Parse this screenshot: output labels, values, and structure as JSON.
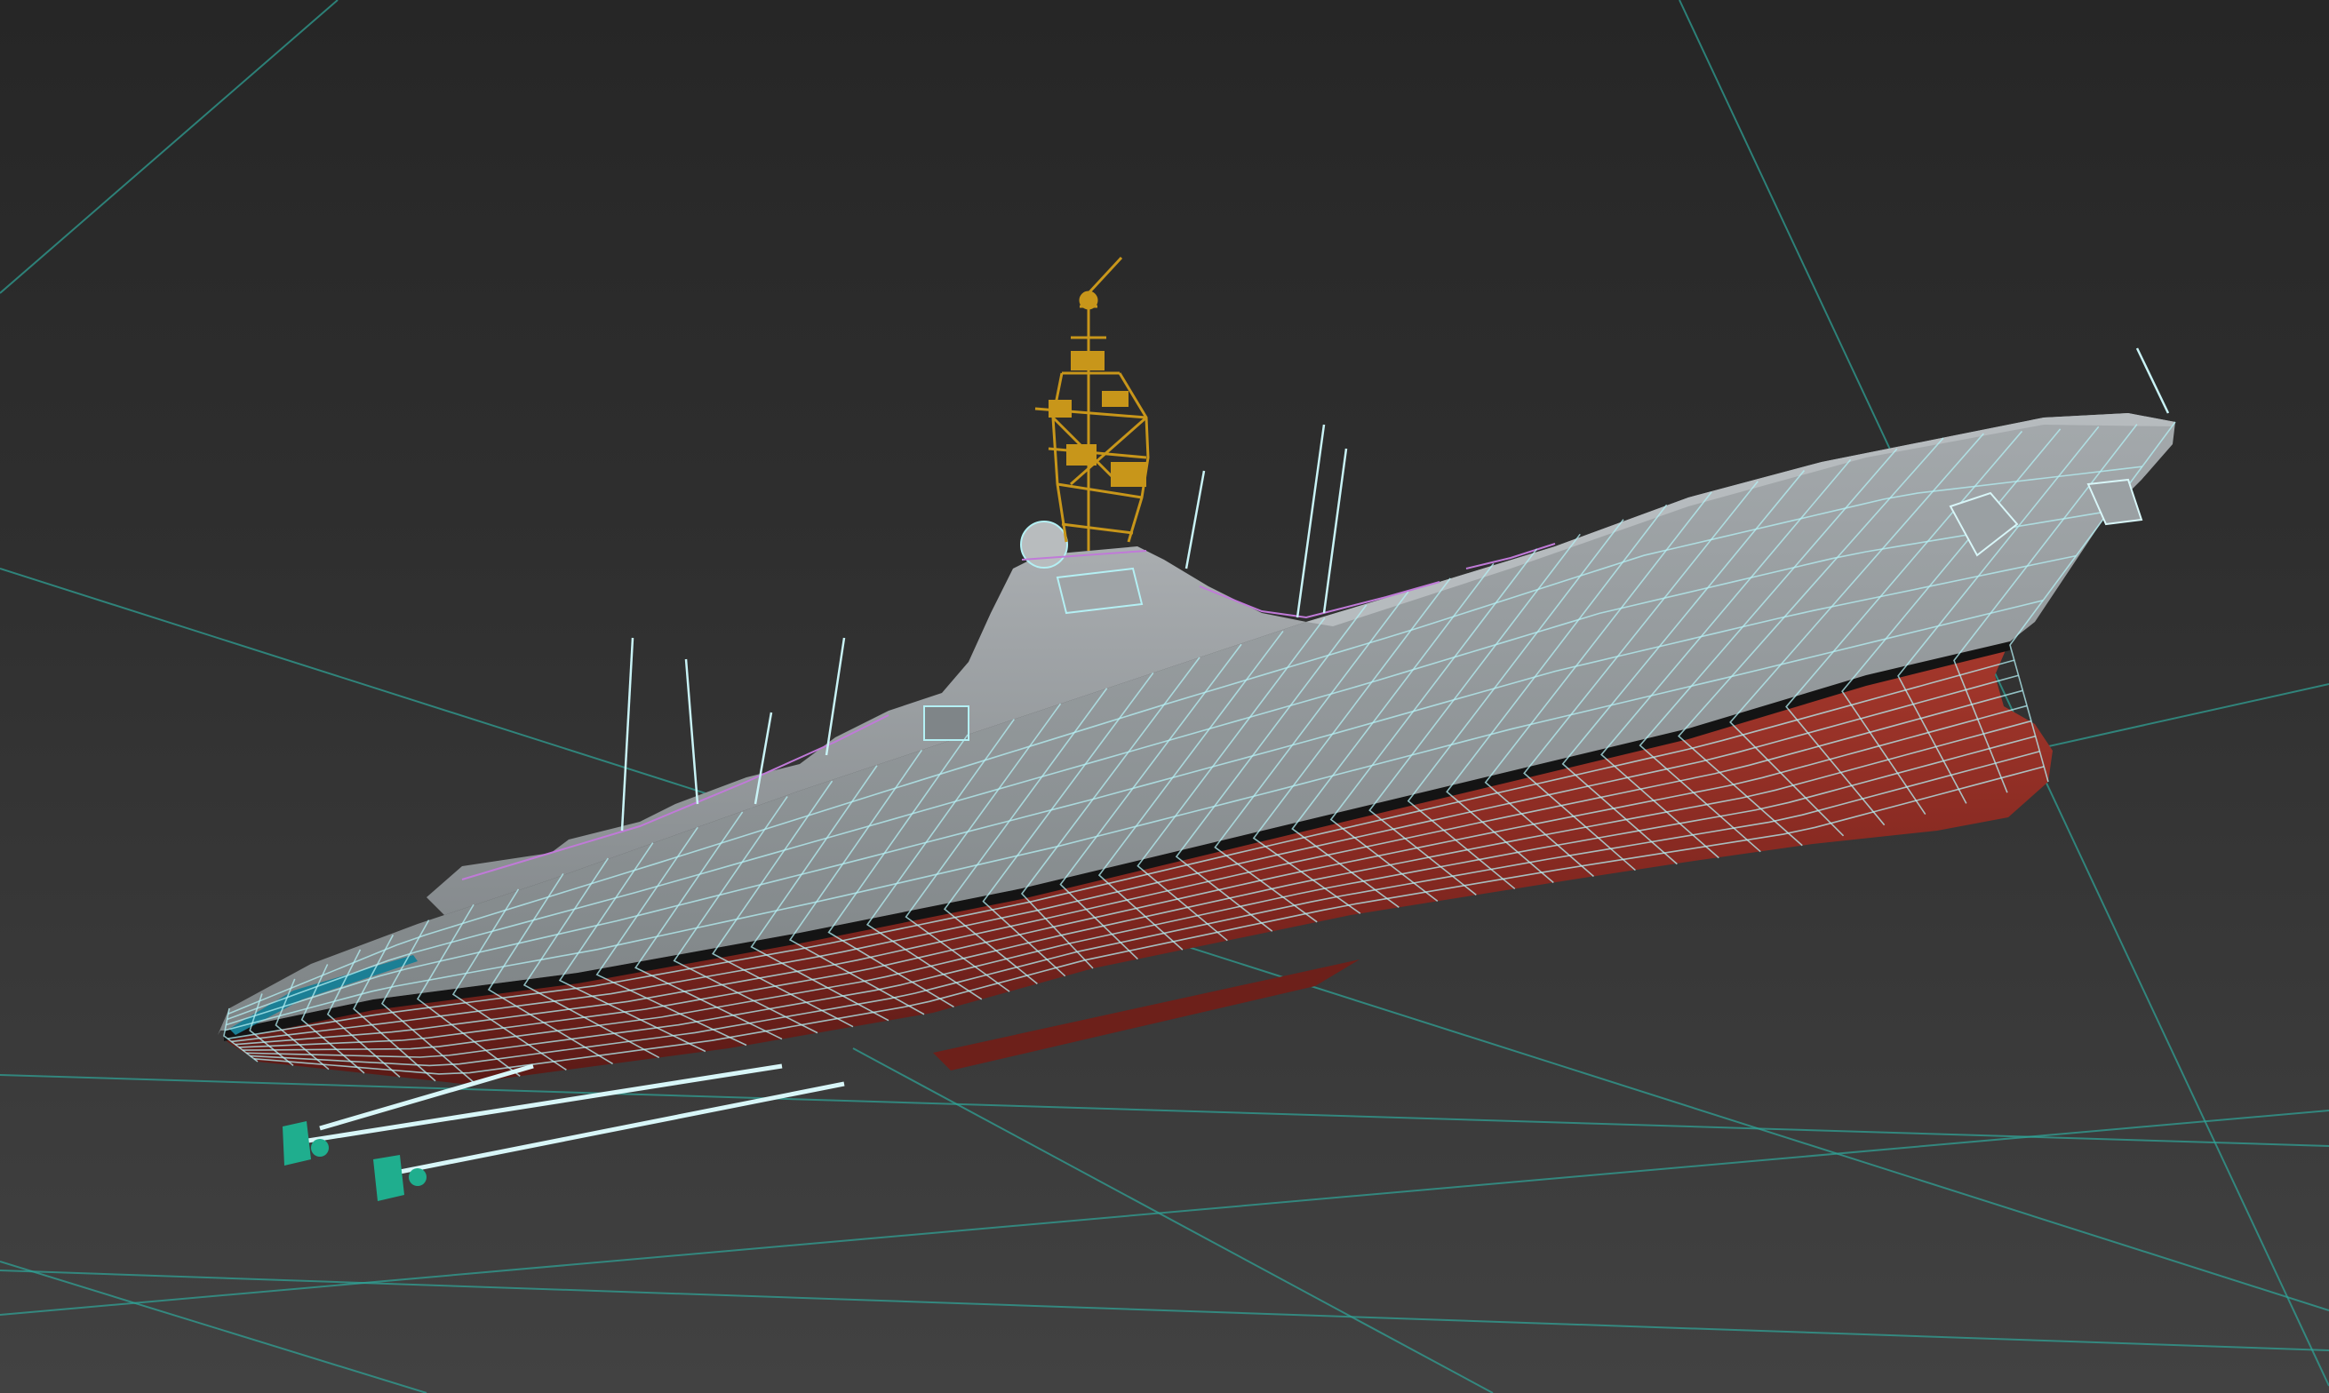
{
  "viewport": {
    "background_top": "#262626",
    "background_bottom": "#424242",
    "grid_color": "#2fa79a",
    "wire_color": "#b4f0f4",
    "hull_lower_color": "#8e2a22",
    "hull_upper_color": "#8d9396",
    "mast_color": "#c8961a",
    "deck_selection_color": "#c07ad8",
    "rudder_color": "#1fae8e",
    "stern_accent_color": "#1b7f95"
  },
  "scene": {
    "object": "ship-model",
    "view": "perspective",
    "render_mode": "shaded-with-wireframe"
  }
}
